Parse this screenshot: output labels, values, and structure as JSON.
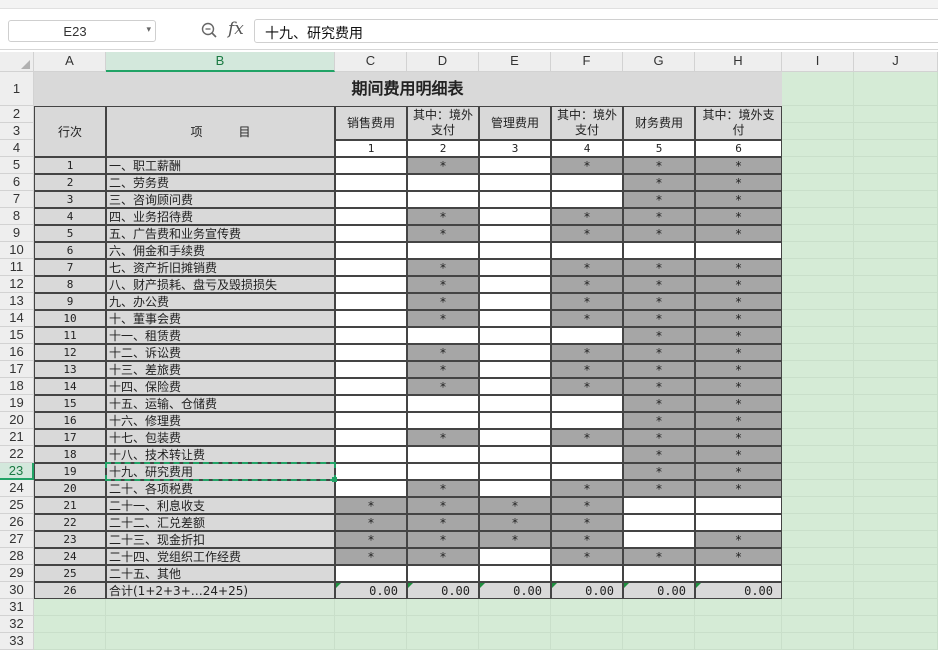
{
  "formula_bar": {
    "cell_ref": "E23",
    "fx_label": "fx",
    "formula": "十九、研究费用"
  },
  "colors": {
    "header_bg": "#eeeeee",
    "selected_header": "#d3e8dc",
    "selection_border": "#21a366",
    "sheet_bg": "#d5ebd6",
    "shaded_cell": "#a6a6a6",
    "light_cell": "#d9d9d9"
  },
  "columns": [
    "A",
    "B",
    "C",
    "D",
    "E",
    "F",
    "G",
    "H",
    "I",
    "J"
  ],
  "rows": [
    "1",
    "2",
    "3",
    "4",
    "5",
    "6",
    "7",
    "8",
    "9",
    "10",
    "11",
    "12",
    "13",
    "14",
    "15",
    "16",
    "17",
    "18",
    "19",
    "20",
    "21",
    "22",
    "23",
    "24",
    "25",
    "26",
    "27",
    "28",
    "29",
    "30",
    "31",
    "32",
    "33"
  ],
  "selected": {
    "col": "B",
    "row": "23"
  },
  "sheet": {
    "title": "期间费用明细表",
    "header": {
      "row_no": "行次",
      "item": "项　　　目",
      "cols": [
        "销售费用",
        "其中：境外支付",
        "管理费用",
        "其中：境外支付",
        "财务费用",
        "其中：境外支付"
      ],
      "col_nos": [
        "1",
        "2",
        "3",
        "4",
        "5",
        "6"
      ]
    },
    "mark": "*",
    "rows": [
      {
        "no": "1",
        "item": "一、职工薪酬",
        "marks": [
          0,
          1,
          0,
          1,
          1,
          1
        ]
      },
      {
        "no": "2",
        "item": "二、劳务费",
        "marks": [
          0,
          0,
          0,
          0,
          1,
          1
        ]
      },
      {
        "no": "3",
        "item": "三、咨询顾问费",
        "marks": [
          0,
          0,
          0,
          0,
          1,
          1
        ]
      },
      {
        "no": "4",
        "item": "四、业务招待费",
        "marks": [
          0,
          1,
          0,
          1,
          1,
          1
        ]
      },
      {
        "no": "5",
        "item": "五、广告费和业务宣传费",
        "marks": [
          0,
          1,
          0,
          1,
          1,
          1
        ]
      },
      {
        "no": "6",
        "item": "六、佣金和手续费",
        "marks": [
          0,
          0,
          0,
          0,
          0,
          0
        ]
      },
      {
        "no": "7",
        "item": "七、资产折旧摊销费",
        "marks": [
          0,
          1,
          0,
          1,
          1,
          1
        ]
      },
      {
        "no": "8",
        "item": "八、财产损耗、盘亏及毁损损失",
        "marks": [
          0,
          1,
          0,
          1,
          1,
          1
        ]
      },
      {
        "no": "9",
        "item": "九、办公费",
        "marks": [
          0,
          1,
          0,
          1,
          1,
          1
        ]
      },
      {
        "no": "10",
        "item": "十、董事会费",
        "marks": [
          0,
          1,
          0,
          1,
          1,
          1
        ]
      },
      {
        "no": "11",
        "item": "十一、租赁费",
        "marks": [
          0,
          0,
          0,
          0,
          1,
          1
        ]
      },
      {
        "no": "12",
        "item": "十二、诉讼费",
        "marks": [
          0,
          1,
          0,
          1,
          1,
          1
        ]
      },
      {
        "no": "13",
        "item": "十三、差旅费",
        "marks": [
          0,
          1,
          0,
          1,
          1,
          1
        ]
      },
      {
        "no": "14",
        "item": "十四、保险费",
        "marks": [
          0,
          1,
          0,
          1,
          1,
          1
        ]
      },
      {
        "no": "15",
        "item": "十五、运输、仓储费",
        "marks": [
          0,
          0,
          0,
          0,
          1,
          1
        ]
      },
      {
        "no": "16",
        "item": "十六、修理费",
        "marks": [
          0,
          0,
          0,
          0,
          1,
          1
        ]
      },
      {
        "no": "17",
        "item": "十七、包装费",
        "marks": [
          0,
          1,
          0,
          1,
          1,
          1
        ]
      },
      {
        "no": "18",
        "item": "十八、技术转让费",
        "marks": [
          0,
          0,
          0,
          0,
          1,
          1
        ]
      },
      {
        "no": "19",
        "item": "十九、研究费用",
        "marks": [
          0,
          0,
          0,
          0,
          1,
          1
        ]
      },
      {
        "no": "20",
        "item": "二十、各项税费",
        "marks": [
          0,
          1,
          0,
          1,
          1,
          1
        ]
      },
      {
        "no": "21",
        "item": "二十一、利息收支",
        "marks": [
          1,
          1,
          1,
          1,
          0,
          0
        ]
      },
      {
        "no": "22",
        "item": "二十二、汇兑差额",
        "marks": [
          1,
          1,
          1,
          1,
          0,
          0
        ]
      },
      {
        "no": "23",
        "item": "二十三、现金折扣",
        "marks": [
          1,
          1,
          1,
          1,
          0,
          1
        ]
      },
      {
        "no": "24",
        "item": "二十四、党组织工作经费",
        "marks": [
          1,
          1,
          0,
          1,
          1,
          1
        ]
      },
      {
        "no": "25",
        "item": "二十五、其他",
        "marks": [
          0,
          0,
          0,
          0,
          0,
          0
        ]
      }
    ],
    "total": {
      "no": "26",
      "item": "合计(1+2+3+…24+25)",
      "values": [
        "0.00",
        "0.00",
        "0.00",
        "0.00",
        "0.00",
        "0.00"
      ]
    }
  }
}
